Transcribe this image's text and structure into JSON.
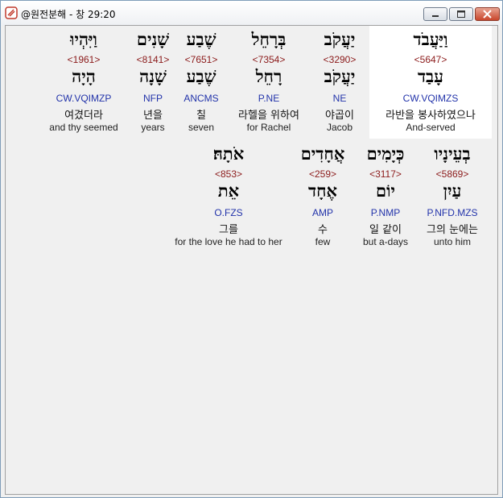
{
  "window": {
    "title": "@원전분해 - 창 29:20"
  },
  "verse_words": [
    {
      "hebrew": "וַיַּעֲבֹד",
      "strong": "<5647>",
      "lexeme": "עָבַד",
      "parsing": "CW.VQIMZS",
      "korean": "라반을 봉사하였으나",
      "english": "And-served",
      "selected": true
    },
    {
      "hebrew": "יַעֲקֹב",
      "strong": "<3290>",
      "lexeme": "יַעֲקֹב",
      "parsing": "NE",
      "korean": "야곱이",
      "english": "Jacob",
      "selected": false
    },
    {
      "hebrew": "בְּרָחֵל",
      "strong": "<7354>",
      "lexeme": "רָחֵל",
      "parsing": "P.NE",
      "korean": "라헬을 위하여",
      "english": "for Rachel",
      "selected": false
    },
    {
      "hebrew": "שֶׁבַע",
      "strong": "<7651>",
      "lexeme": "שֶׁבַע",
      "parsing": "ANCMS",
      "korean": "칠",
      "english": "seven",
      "selected": false
    },
    {
      "hebrew": "שָׁנִים",
      "strong": "<8141>",
      "lexeme": "שָׁנָה",
      "parsing": "NFP",
      "korean": "년을",
      "english": "years",
      "selected": false
    },
    {
      "hebrew": "וַיִּהְיוּ",
      "strong": "<1961>",
      "lexeme": "הָיָה",
      "parsing": "CW.VQIMZP",
      "korean": "여겼더라",
      "english": "and thy seemed",
      "selected": false
    },
    {
      "hebrew": "בְעֵינָיו",
      "strong": "<5869>",
      "lexeme": "עַיִן",
      "parsing": "P.NFD.MZS",
      "korean": "그의 눈에는",
      "english": "unto him",
      "selected": false
    },
    {
      "hebrew": "כְּיָמִים",
      "strong": "<3117>",
      "lexeme": "יוֹם",
      "parsing": "P.NMP",
      "korean": "일 같이",
      "english": "but a-days",
      "selected": false
    },
    {
      "hebrew": "אֲחָדִים",
      "strong": "<259>",
      "lexeme": "אֶחָד",
      "parsing": "AMP",
      "korean": "수",
      "english": "few",
      "selected": false
    },
    {
      "hebrew": "אֹתָהּ׃",
      "strong": "<853>",
      "lexeme": "אֵת",
      "parsing": "O.FZS",
      "korean": "그를",
      "english": "for the love he had to her",
      "selected": false
    }
  ]
}
